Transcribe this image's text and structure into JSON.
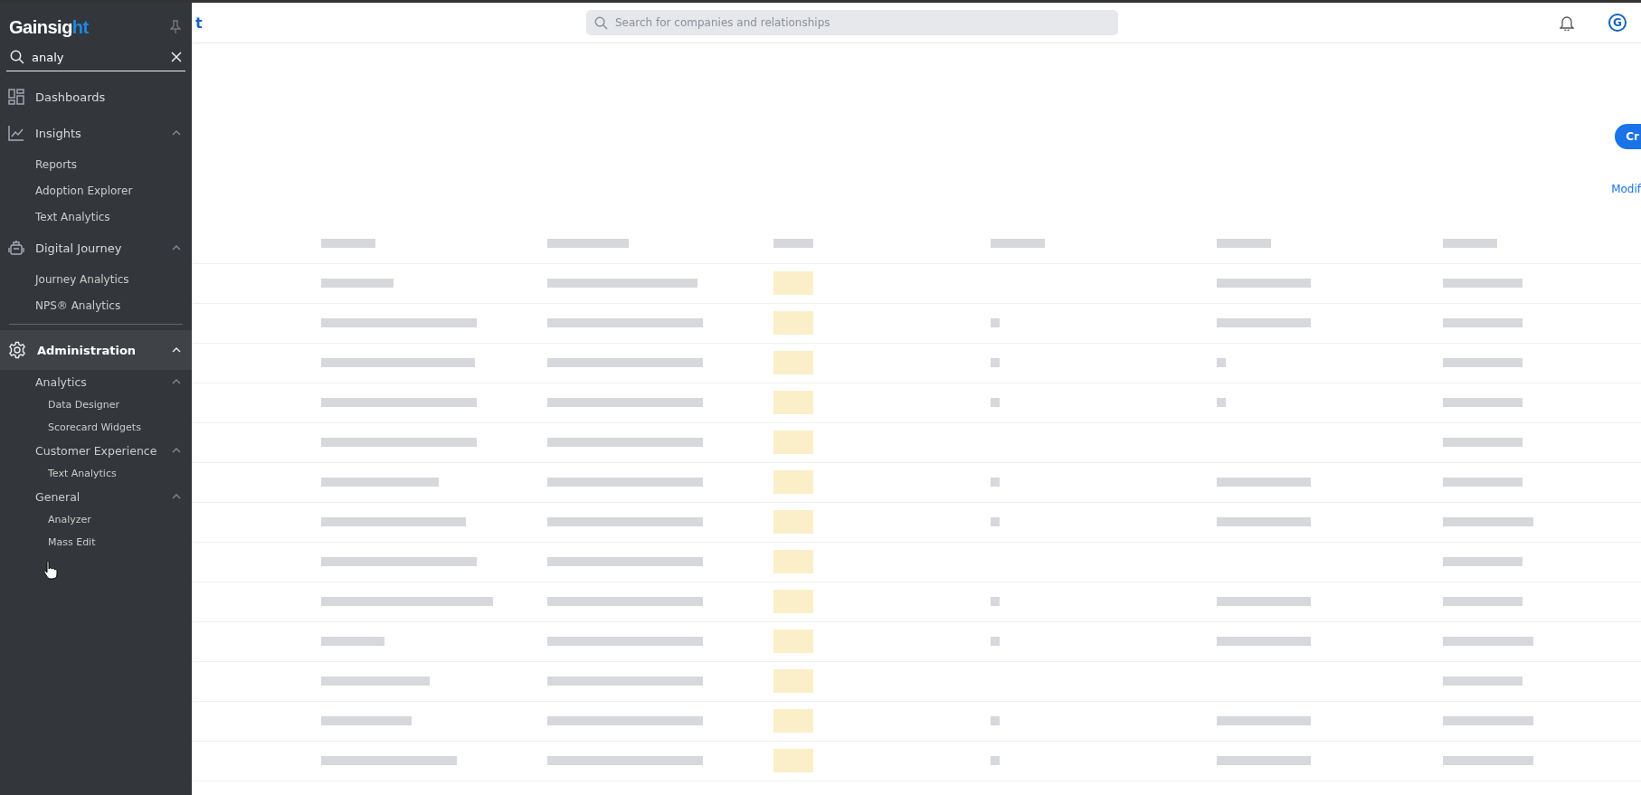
{
  "sidebar": {
    "logo": {
      "text": "Gainsig",
      "accent": "ht"
    },
    "search": {
      "value": "analy"
    },
    "nav": [
      {
        "label": "Dashboards",
        "selected": false
      },
      {
        "label": "Insights",
        "selected": false,
        "expanded": true,
        "children": [
          {
            "label": "Reports"
          },
          {
            "label": "Adoption Explorer"
          },
          {
            "label": "Text Analytics"
          }
        ]
      },
      {
        "label": "Digital Journey",
        "selected": false,
        "expanded": true,
        "children": [
          {
            "label": "Journey Analytics"
          },
          {
            "label": "NPS® Analytics"
          }
        ]
      },
      {
        "label": "Administration",
        "selected": true,
        "expanded": true,
        "children": [
          {
            "label": "Analytics",
            "expanded": true,
            "children": [
              {
                "label": "Data Designer"
              },
              {
                "label": "Scorecard Widgets"
              }
            ]
          },
          {
            "label": "Customer Experience",
            "expanded": true,
            "children": [
              {
                "label": "Text Analytics"
              }
            ]
          },
          {
            "label": "General",
            "expanded": true,
            "children": [
              {
                "label": "Analyzer"
              },
              {
                "label": "Mass Edit"
              }
            ]
          }
        ]
      }
    ]
  },
  "header": {
    "title_fragment": "t",
    "search": {
      "placeholder": "Search for companies and relationships"
    },
    "avatar": "G"
  },
  "content": {
    "create_button": "Cr",
    "modify_link": "Modif"
  }
}
